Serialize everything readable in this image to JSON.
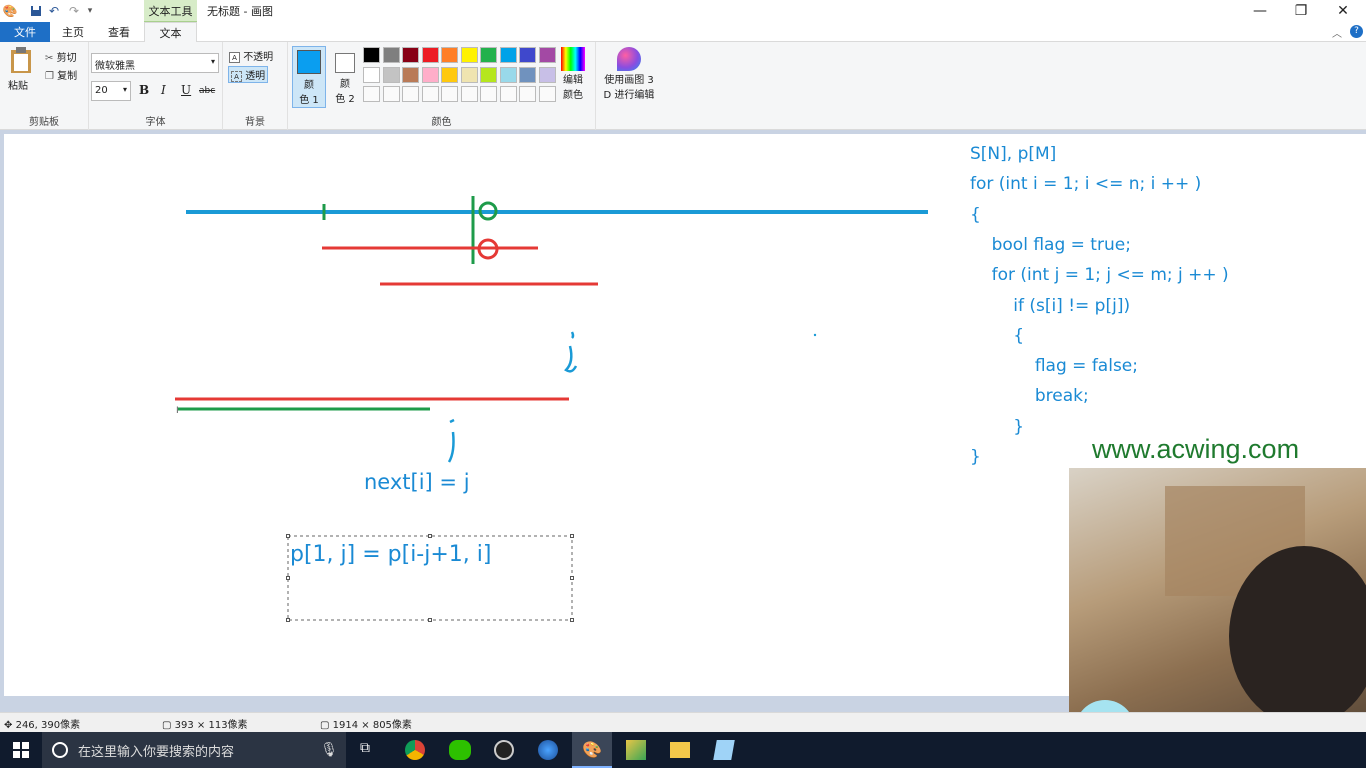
{
  "window": {
    "title": "无标题 - 画图",
    "context_tab": "文本工具",
    "minimize": "—",
    "restore": "❐",
    "close": "✕"
  },
  "tabs": {
    "file": "文件",
    "home": "主页",
    "view": "查看",
    "text": "文本"
  },
  "ribbon": {
    "clipboard": {
      "paste": "粘贴",
      "cut": "剪切",
      "copy": "复制",
      "group": "剪贴板"
    },
    "font": {
      "family": "微软雅黑",
      "size": "20",
      "bold": "B",
      "italic": "I",
      "underline": "U",
      "strike": "abc",
      "group": "字体"
    },
    "background": {
      "opaque": "不透明",
      "transparent": "透明",
      "group": "背景"
    },
    "colors": {
      "color1": "颜色 1",
      "color1_a": "颜",
      "color1_b": "色 1",
      "color2_a": "颜",
      "color2_b": "色 2",
      "edit_a": "编辑",
      "edit_b": "颜色",
      "paint3d_a": "使用画图 3",
      "paint3d_b": "D 进行编辑",
      "group": "颜色",
      "color1_value": "#0a9ef0",
      "color2_value": "#ffffff",
      "palette_row1": [
        "#000000",
        "#7f7f7f",
        "#880015",
        "#ed1c24",
        "#ff7f27",
        "#fff200",
        "#22b14c",
        "#00a2e8",
        "#3f48cc",
        "#a349a4"
      ],
      "palette_row2": [
        "#ffffff",
        "#c3c3c3",
        "#b97a57",
        "#ffaec9",
        "#ffc90e",
        "#efe4b0",
        "#b5e61d",
        "#99d9ea",
        "#7092be",
        "#c8bfe7"
      ]
    }
  },
  "canvas": {
    "code_lines": [
      "S[N], p[M]",
      "for (int i = 1; i <= n; i ++ )",
      "{",
      "    bool flag = true;",
      "    for (int j = 1; j <= m; j ++ )",
      "        if (s[i] != p[j])",
      "        {",
      "            flag = false;",
      "            break;",
      "        }",
      "}"
    ],
    "label_i": "i",
    "label_j": "j",
    "next_text": "next[i] = j",
    "textbox_text": "p[1, j] = p[i-j+1, i]",
    "watermark": "www.acwing.com",
    "colors": {
      "blue": "#1a9ad6",
      "red": "#e53935",
      "green": "#1e9b4a",
      "text": "#1a8ad4"
    }
  },
  "status": {
    "cursor": "246, 390像素",
    "selection": "393 × 113像素",
    "canvas_size": "1914 × 805像素"
  },
  "taskbar": {
    "search_placeholder": "在这里输入你要搜索的内容"
  }
}
